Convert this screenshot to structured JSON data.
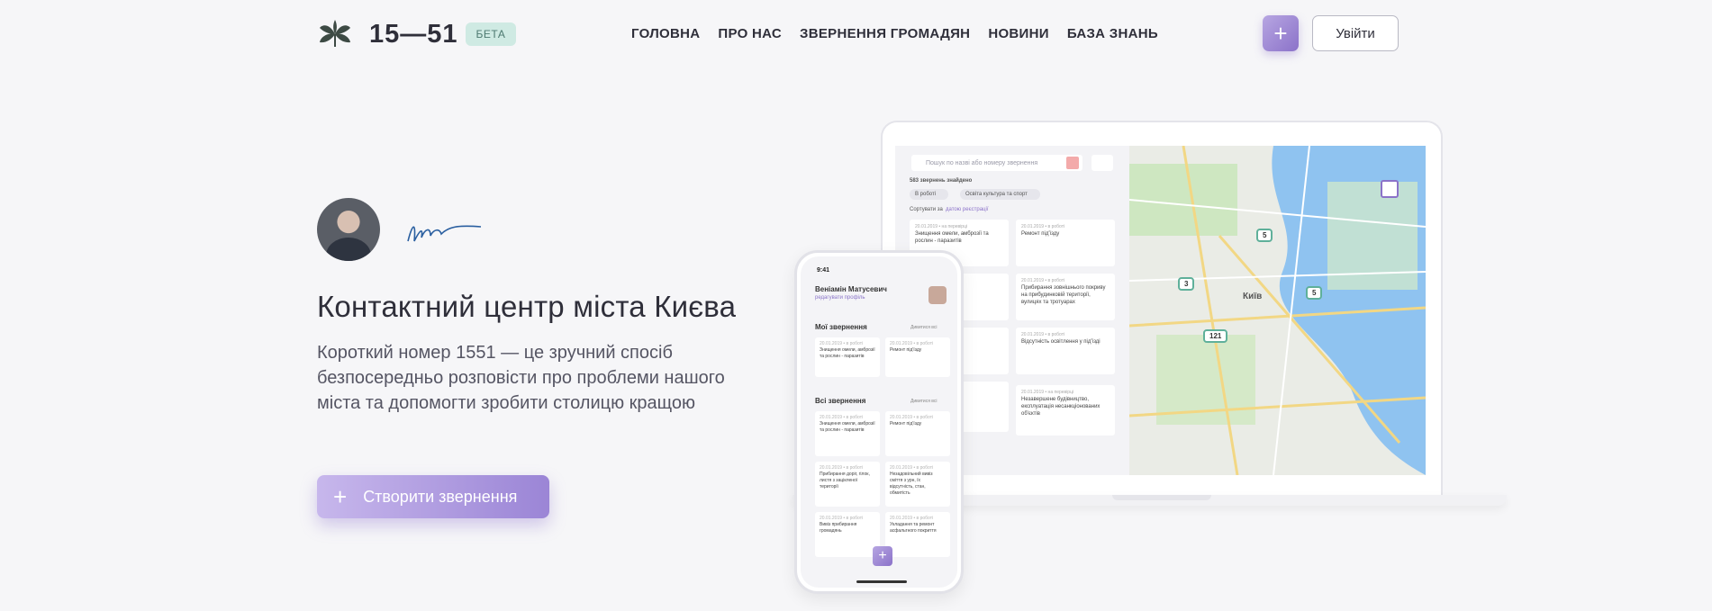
{
  "header": {
    "logo_text": "15—51",
    "beta_label": "БЕТА",
    "nav": [
      "ГОЛОВНА",
      "ПРО НАС",
      "ЗВЕРНЕННЯ ГРОМАДЯН",
      "НОВИНИ",
      "БАЗА ЗНАНЬ"
    ],
    "plus_icon": "+",
    "login_label": "Увійти"
  },
  "hero": {
    "title": "Контактний центр міста Києва",
    "description": "Короткий номер 1551 — це зручний спосіб безпосередньо розповісти про проблеми нашого міста та допомогти зробити столицю кращою",
    "cta_label": "Створити звернення",
    "cta_icon": "+"
  },
  "laptop": {
    "search_placeholder": "Пошук по назві або номеру звернення",
    "results": "583 звернень знайдено",
    "chips": [
      "В роботі",
      "Освіта культура та спорт"
    ],
    "sort_label": "Сортувати за",
    "sort_value": "датою реєстрації",
    "cards": [
      {
        "meta": "20.01.2019 • на перевірці",
        "text": "Знищення омели, амброзії та рослин - паразитів"
      },
      {
        "meta": "20.01.2019 • в роботі",
        "text": "Ремонт під'їзду"
      },
      {
        "meta": "20.01.2019 • в роботі",
        "text": "Прибирання зовнішнього покриву на прибудинковій території, вулицях та тротуарах"
      },
      {
        "meta": "20.01.2019 • в роботі",
        "text": "Відсутність освітлення у під'їзді"
      },
      {
        "meta": "20.01.2019 • на перевірці",
        "text": "Незавершене будівництво, експлуатація несанкціонованих об'єктів"
      }
    ],
    "map_markers": [
      "5",
      "3",
      "5",
      "121"
    ],
    "map_city": "Київ"
  },
  "phone": {
    "time": "9:41",
    "user": "Веніамін Матусевич",
    "user_sub": "редагувати профіль",
    "my_title": "Мої звернення",
    "all_title": "Всі звернення",
    "see_all": "Дивитися всі",
    "my_cards": [
      {
        "meta": "20.01.2019 • в роботі",
        "text": "Знищення омели, амброзії та рослин - паразитів"
      },
      {
        "meta": "20.01.2019 • в роботі",
        "text": "Ремонт під'їзду"
      }
    ],
    "all_cards": [
      {
        "meta": "20.01.2019 • в роботі",
        "text": "Знищення омели, амброзії та рослин - паразитів"
      },
      {
        "meta": "20.01.2019 • в роботі",
        "text": "Ремонт під'їзду"
      },
      {
        "meta": "20.01.2019 • в роботі",
        "text": "Прибирання доріг, гілок, листя з зацікленої території"
      },
      {
        "meta": "20.01.2019 • в роботі",
        "text": "Незадовільний вивіз сміття з урн, їх відсутність, стан, обмитість"
      },
      {
        "meta": "20.01.2019 • в роботі",
        "text": "Вивіз прибирання громадянь"
      },
      {
        "meta": "20.01.2019 • в роботі",
        "text": "Укладання та ремонт асфальтного покриття"
      }
    ],
    "fab": "+"
  },
  "colors": {
    "accent": "#9b85d6",
    "beta_bg": "#cfeae3",
    "text": "#2f2f3a"
  }
}
